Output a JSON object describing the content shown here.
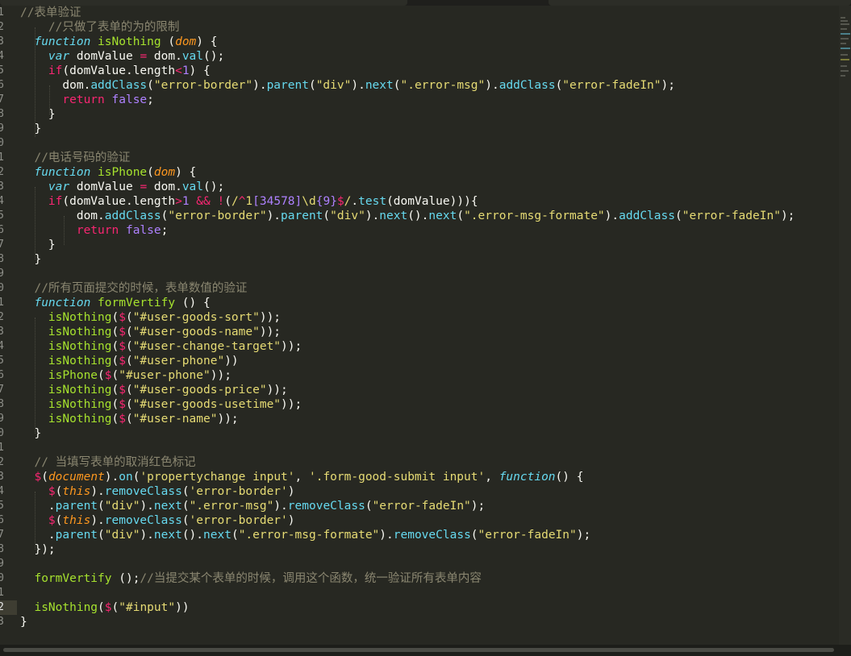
{
  "code": {
    "active_line_index": 41,
    "lines": [
      {
        "num": "1",
        "html": "<span class=\"c\">//表单验证</span>"
      },
      {
        "num": "2",
        "html": "    <span class=\"c\">//只做了表单的为的限制</span>"
      },
      {
        "num": "3",
        "html": "  <span class=\"k\">function</span> <span class=\"f\">isNothing</span> (<span class=\"p\">dom</span>) {"
      },
      {
        "num": "4",
        "html": "    <span class=\"k\">var</span> domValue <span class=\"o\">=</span> dom.<span class=\"m\">val</span>();"
      },
      {
        "num": "5",
        "html": "    <span class=\"o\">if</span>(domValue.length<span class=\"o\">&lt;</span><span class=\"n\">1</span>) {"
      },
      {
        "num": "6",
        "html": "      dom.<span class=\"m\">addClass</span>(<span class=\"s\">\"error-border\"</span>).<span class=\"m\">parent</span>(<span class=\"s\">\"div\"</span>).<span class=\"m\">next</span>(<span class=\"s\">\".error-msg\"</span>).<span class=\"m\">addClass</span>(<span class=\"s\">\"error-fadeIn\"</span>);"
      },
      {
        "num": "7",
        "html": "      <span class=\"o\">return</span> <span class=\"n\">false</span>;"
      },
      {
        "num": "8",
        "html": "    }"
      },
      {
        "num": "9",
        "html": "  }"
      },
      {
        "num": "0",
        "html": ""
      },
      {
        "num": "1",
        "html": "  <span class=\"c\">//电话号码的验证</span>"
      },
      {
        "num": "2",
        "html": "  <span class=\"k\">function</span> <span class=\"f\">isPhone</span>(<span class=\"p\">dom</span>) {"
      },
      {
        "num": "3",
        "html": "    <span class=\"k\">var</span> domValue <span class=\"o\">=</span> dom.<span class=\"m\">val</span>();"
      },
      {
        "num": "4",
        "html": "    <span class=\"o\">if</span>(domValue.length<span class=\"o\">&gt;</span><span class=\"n\">1</span> <span class=\"o\">&amp;&amp;</span> <span class=\"o\">!</span>(<span class=\"s\">/</span><span class=\"o\">^</span><span class=\"s\">1</span><span class=\"n\">[34578]</span><span class=\"s\">\\d</span><span class=\"n\">{9}</span><span class=\"o\">$</span><span class=\"s\">/</span>.<span class=\"m\">test</span>(domValue))){"
      },
      {
        "num": "5",
        "html": "        dom.<span class=\"m\">addClass</span>(<span class=\"s\">\"error-border\"</span>).<span class=\"m\">parent</span>(<span class=\"s\">\"div\"</span>).<span class=\"m\">next</span>().<span class=\"m\">next</span>(<span class=\"s\">\".error-msg-formate\"</span>).<span class=\"m\">addClass</span>(<span class=\"s\">\"error-fadeIn\"</span>);"
      },
      {
        "num": "6",
        "html": "        <span class=\"o\">return</span> <span class=\"n\">false</span>;"
      },
      {
        "num": "7",
        "html": "    }"
      },
      {
        "num": "8",
        "html": "  }"
      },
      {
        "num": "9",
        "html": ""
      },
      {
        "num": "0",
        "html": "  <span class=\"c\">//所有页面提交的时候，表单数值的验证</span>"
      },
      {
        "num": "1",
        "html": "  <span class=\"k\">function</span> <span class=\"f\">formVertify</span> () {"
      },
      {
        "num": "2",
        "html": "    <span class=\"f\">isNothing</span>(<span class=\"o\">$</span>(<span class=\"s\">\"#user-goods-sort\"</span>));"
      },
      {
        "num": "3",
        "html": "    <span class=\"f\">isNothing</span>(<span class=\"o\">$</span>(<span class=\"s\">\"#user-goods-name\"</span>));"
      },
      {
        "num": "4",
        "html": "    <span class=\"f\">isNothing</span>(<span class=\"o\">$</span>(<span class=\"s\">\"#user-change-target\"</span>));"
      },
      {
        "num": "5",
        "html": "    <span class=\"f\">isNothing</span>(<span class=\"o\">$</span>(<span class=\"s\">\"#user-phone\"</span>))"
      },
      {
        "num": "6",
        "html": "    <span class=\"f\">isPhone</span>(<span class=\"o\">$</span>(<span class=\"s\">\"#user-phone\"</span>));"
      },
      {
        "num": "7",
        "html": "    <span class=\"f\">isNothing</span>(<span class=\"o\">$</span>(<span class=\"s\">\"#user-goods-price\"</span>));"
      },
      {
        "num": "8",
        "html": "    <span class=\"f\">isNothing</span>(<span class=\"o\">$</span>(<span class=\"s\">\"#user-goods-usetime\"</span>));"
      },
      {
        "num": "9",
        "html": "    <span class=\"f\">isNothing</span>(<span class=\"o\">$</span>(<span class=\"s\">\"#user-name\"</span>));"
      },
      {
        "num": "0",
        "html": "  }"
      },
      {
        "num": "1",
        "html": ""
      },
      {
        "num": "2",
        "html": "  <span class=\"c\">// 当填写表单的取消红色标记</span>"
      },
      {
        "num": "3",
        "html": "  <span class=\"o\">$</span>(<span class=\"p\">document</span>).<span class=\"m\">on</span>(<span class=\"s\">'propertychange input'</span>, <span class=\"s\">'.form-good-submit input'</span>, <span class=\"k\">function</span>() {"
      },
      {
        "num": "4",
        "html": "    <span class=\"o\">$</span>(<span class=\"p\">this</span>).<span class=\"m\">removeClass</span>(<span class=\"s\">'error-border'</span>)"
      },
      {
        "num": "5",
        "html": "    .<span class=\"m\">parent</span>(<span class=\"s\">\"div\"</span>).<span class=\"m\">next</span>(<span class=\"s\">\".error-msg\"</span>).<span class=\"m\">removeClass</span>(<span class=\"s\">\"error-fadeIn\"</span>);"
      },
      {
        "num": "6",
        "html": "    <span class=\"o\">$</span>(<span class=\"p\">this</span>).<span class=\"m\">removeClass</span>(<span class=\"s\">'error-border'</span>)"
      },
      {
        "num": "7",
        "html": "    .<span class=\"m\">parent</span>(<span class=\"s\">\"div\"</span>).<span class=\"m\">next</span>().<span class=\"m\">next</span>(<span class=\"s\">\".error-msg-formate\"</span>).<span class=\"m\">removeClass</span>(<span class=\"s\">\"error-fadeIn\"</span>);"
      },
      {
        "num": "8",
        "html": "  });"
      },
      {
        "num": "9",
        "html": ""
      },
      {
        "num": "0",
        "html": "  <span class=\"f\">formVertify</span> ();<span class=\"c\">//当提交某个表单的时候，调用这个函数，统一验证所有表单内容</span>"
      },
      {
        "num": "1",
        "html": ""
      },
      {
        "num": "2",
        "html": "  <span class=\"f\">isNothing</span>(<span class=\"o\">$</span>(<span class=\"s\">\"#input\"</span>))"
      },
      {
        "num": "3",
        "html": "}"
      }
    ]
  }
}
